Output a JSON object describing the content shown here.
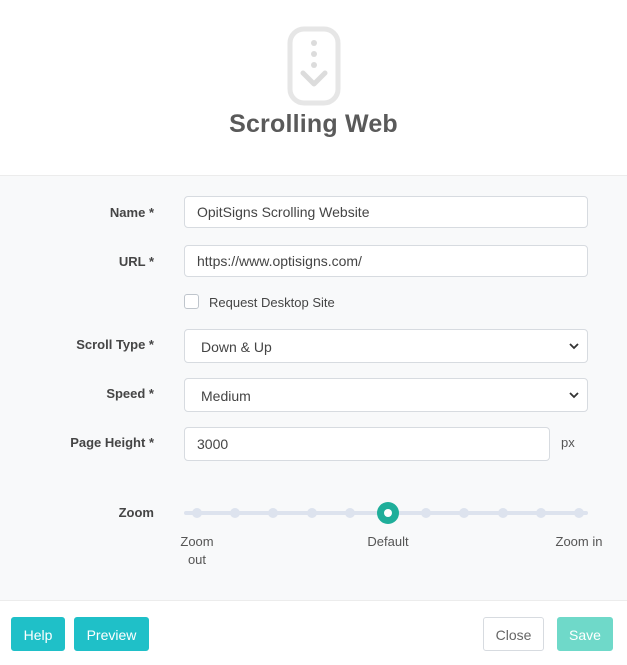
{
  "header": {
    "title": "Scrolling Web",
    "icon": "scroll-down-phone-icon"
  },
  "form": {
    "name": {
      "label": "Name *",
      "value": "OpitSigns Scrolling Website"
    },
    "url": {
      "label": "URL *",
      "value": "https://www.optisigns.com/"
    },
    "desktop": {
      "label": "Request Desktop Site",
      "checked": false
    },
    "scroll_type": {
      "label": "Scroll Type *",
      "value": "Down & Up"
    },
    "speed": {
      "label": "Speed *",
      "value": "Medium"
    },
    "page_height": {
      "label": "Page Height *",
      "value": "3000",
      "unit": "px"
    },
    "zoom": {
      "label": "Zoom",
      "steps": 11,
      "selected_index": 5,
      "min_label": "Zoom out",
      "default_label": "Default",
      "max_label": "Zoom in"
    }
  },
  "footer": {
    "help": "Help",
    "preview": "Preview",
    "close": "Close",
    "save": "Save"
  },
  "colors": {
    "accent": "#1fc0c8",
    "knob": "#1fae9a",
    "save_disabled": "#6fd9c9"
  }
}
